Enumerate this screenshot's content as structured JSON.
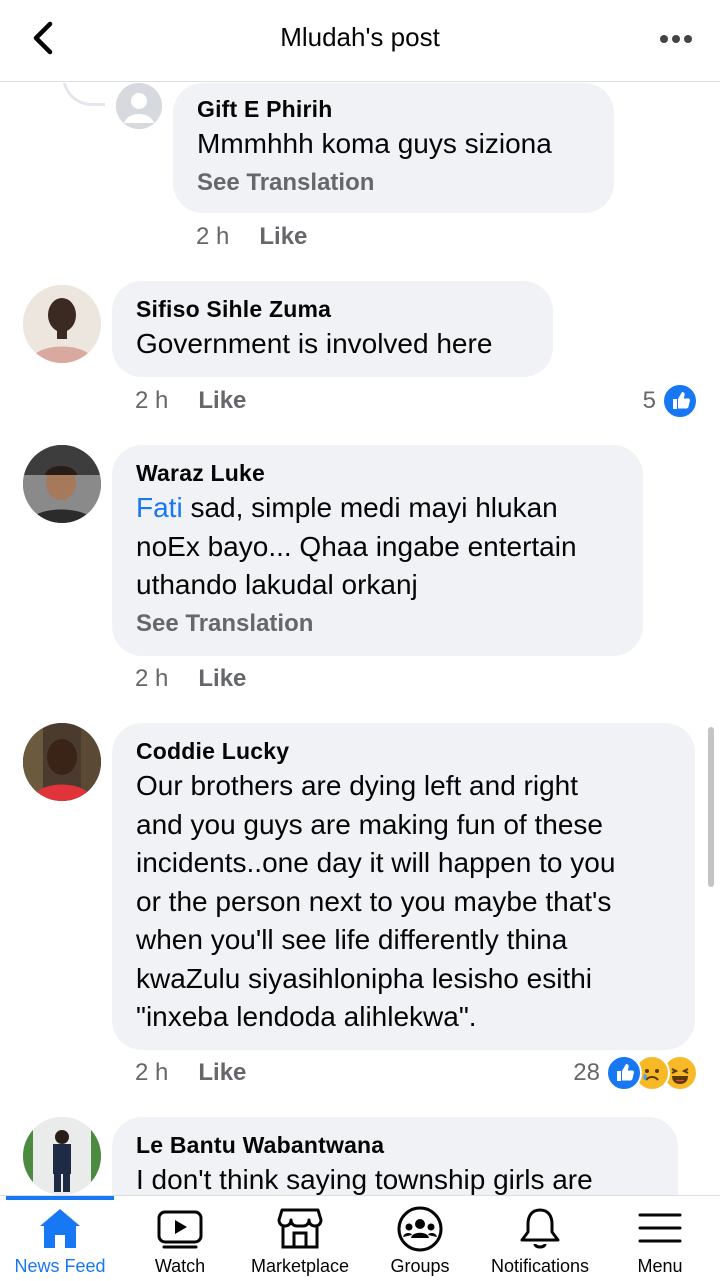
{
  "header": {
    "title": "Mludah's post"
  },
  "comments": [
    {
      "author": "Gift E Phirih",
      "text": "Mmmhhh koma guys siziona",
      "see_translation": "See Translation",
      "time": "2 h",
      "like": "Like"
    },
    {
      "author": "Sifiso Sihle Zuma",
      "text": "Government is involved here",
      "time": "2 h",
      "like": "Like",
      "reaction_count": "5"
    },
    {
      "author": "Waraz Luke",
      "mention": "Fati",
      "text_line1": " sad, simple medi mayi hlukan",
      "text_line2": "noEx bayo... Qhaa ingabe entertain",
      "text_line3": "uthando lakudal orkanj",
      "see_translation": "See Translation",
      "time": "2 h",
      "like": "Like"
    },
    {
      "author": "Coddie Lucky",
      "lines": [
        "Our brothers are dying left and right",
        "and you guys are making fun of these",
        "incidents..one day it will happen to you",
        "or the person next to you maybe that's",
        "when you'll see life differently thina",
        "kwaZulu siyasihlonipha lesisho esithi",
        "\"inxeba lendoda alihlekwa\"."
      ],
      "time": "2 h",
      "like": "Like",
      "reaction_count": "28"
    },
    {
      "author": "Le Bantu Wabantwana",
      "text": "I don't think saying township girls are"
    }
  ],
  "tabs": [
    {
      "label": "News Feed",
      "icon": "home-icon"
    },
    {
      "label": "Watch",
      "icon": "video-icon"
    },
    {
      "label": "Marketplace",
      "icon": "shop-icon"
    },
    {
      "label": "Groups",
      "icon": "groups-icon"
    },
    {
      "label": "Notifications",
      "icon": "bell-icon"
    },
    {
      "label": "Menu",
      "icon": "menu-icon"
    }
  ],
  "colors": {
    "accent": "#1877f2",
    "bubble": "#f0f2f5",
    "secondary_text": "#65676b"
  }
}
